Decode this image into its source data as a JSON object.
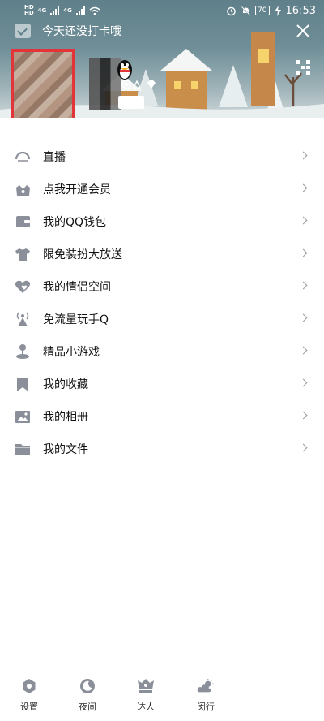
{
  "status_bar": {
    "network_tag_1": "HD",
    "network_tag_2": "HD",
    "gen_1": "4G",
    "gen_2": "4G",
    "battery": "70",
    "time": "16:53"
  },
  "header": {
    "checkin_text": "今天还没打卡哦"
  },
  "menu": {
    "items": [
      {
        "label": "直播",
        "icon": "live-icon"
      },
      {
        "label": "点我开通会员",
        "icon": "vip-crown-icon"
      },
      {
        "label": "我的QQ钱包",
        "icon": "wallet-icon"
      },
      {
        "label": "限免装扮大放送",
        "icon": "tshirt-icon"
      },
      {
        "label": "我的情侣空间",
        "icon": "hearts-icon"
      },
      {
        "label": "免流量玩手Q",
        "icon": "antenna-icon"
      },
      {
        "label": "精品小游戏",
        "icon": "joystick-icon"
      },
      {
        "label": "我的收藏",
        "icon": "bookmark-icon"
      },
      {
        "label": "我的相册",
        "icon": "photo-icon"
      },
      {
        "label": "我的文件",
        "icon": "folder-icon"
      }
    ]
  },
  "bottom_bar": {
    "settings": "设置",
    "night": "夜间",
    "expert": "达人",
    "weather": "闵行"
  },
  "colors": {
    "icon_gray": "#8a8f99",
    "avatar_highlight": "#e3343a",
    "banner_top": "#5f7f8a"
  }
}
